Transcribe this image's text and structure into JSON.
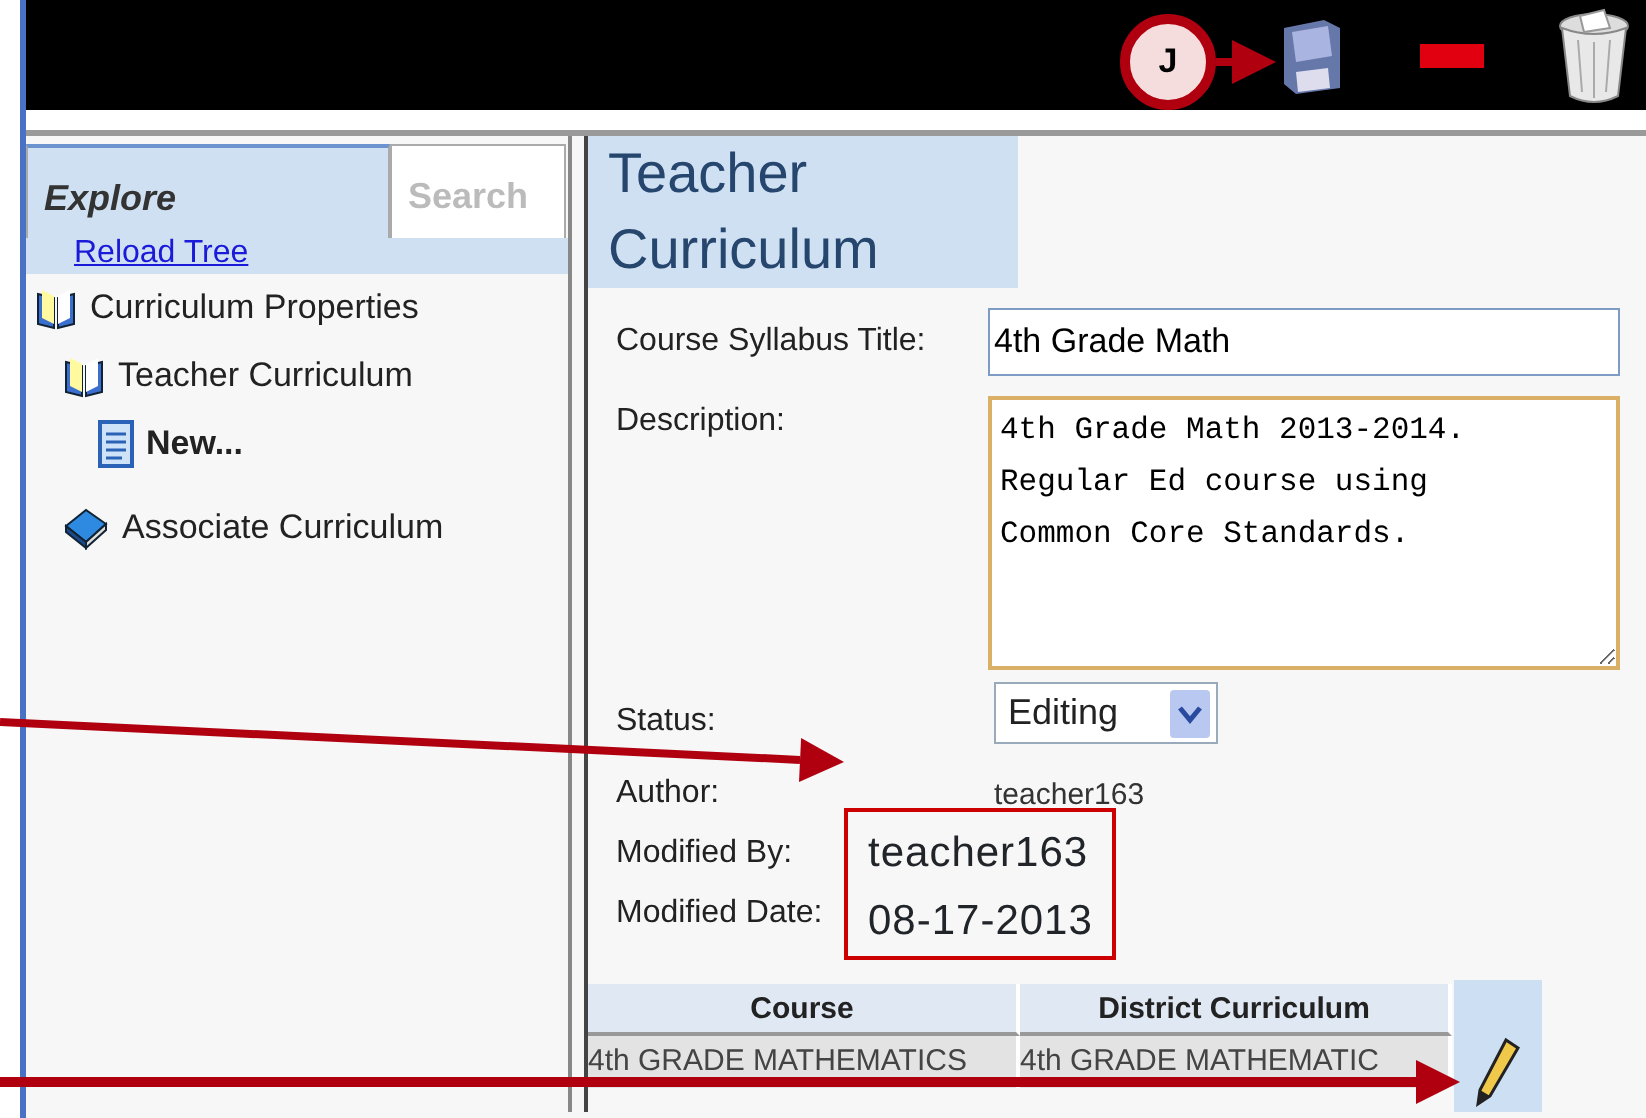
{
  "toolbar": {
    "callout": "J",
    "buttons": [
      {
        "kind": "save"
      },
      {
        "kind": "remove"
      },
      {
        "kind": "delete"
      }
    ]
  },
  "sidebar": {
    "tabs": [
      {
        "label": "Explore",
        "selected": true
      },
      {
        "label": "Search",
        "selected": false
      }
    ],
    "reload_link": "Reload Tree",
    "tree": [
      {
        "label": "Curriculum Properties",
        "kind": "folder",
        "children": [
          {
            "label": "Teacher Curriculum",
            "kind": "folder",
            "children": [
              {
                "label": "New...",
                "kind": "new"
              }
            ]
          },
          {
            "label": "Associate Curriculum",
            "kind": "book"
          }
        ]
      }
    ]
  },
  "form": {
    "heading": "Teacher Curriculum",
    "fields": [
      {
        "label": "Course Syllabus Title:",
        "kind": "text",
        "value": "4th Grade Math"
      },
      {
        "label": "Description:",
        "kind": "textarea",
        "value": "4th Grade Math 2013-2014.\nRegular Ed course using\nCommon Core Standards.",
        "focused": true
      },
      {
        "label": "Status:",
        "kind": "select",
        "value": "Editing"
      },
      {
        "label": "Author:",
        "kind": "static",
        "value": "teacher163"
      },
      {
        "label": "Modified By:",
        "kind": "highlight",
        "value": "teacher163"
      },
      {
        "label": "Modified Date:",
        "kind": "highlight",
        "value": "08-17-2013"
      }
    ]
  },
  "table": {
    "columns": [
      "Course",
      "District Curriculum"
    ],
    "rows": [
      [
        "4th GRADE MATHEMATICS",
        "4th GRADE MATHEMATIC"
      ]
    ]
  }
}
